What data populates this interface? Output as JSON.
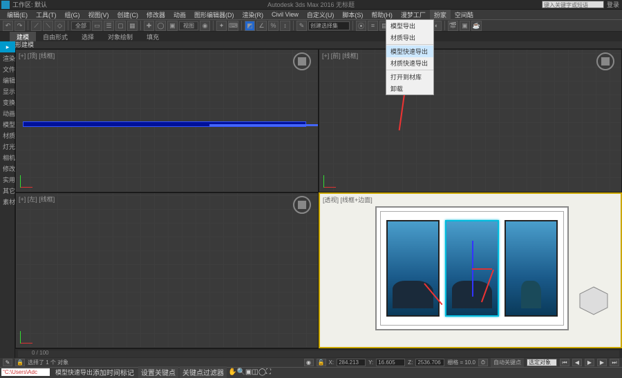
{
  "title": "Autodesk 3ds Max 2016   无标题",
  "workspace": "工作区: 默认",
  "search_placeholder": "键入关键字或短语",
  "login": "登录",
  "menubar": [
    "编辑(E)",
    "工具(T)",
    "组(G)",
    "视图(V)",
    "创建(C)",
    "修改器",
    "动画",
    "图形编辑器(D)",
    "渲染(R)",
    "Civil View",
    "自定义(U)",
    "脚本(S)",
    "帮助(H)",
    "漫梦工厂",
    "扮家",
    "空间酷"
  ],
  "toolbar_dd1": "全部",
  "toolbar_dd2": "视图",
  "toolbar_dd3": "创建选择集",
  "tabs": [
    "建模",
    "自由形式",
    "选择",
    "对象绘制",
    "填充"
  ],
  "subheader": "多边形建模",
  "left_items": [
    "渲染",
    "文件",
    "编辑",
    "显示",
    "变换",
    "动画",
    "模型",
    "材质",
    "灯光",
    "相机",
    "修改",
    "实用",
    "其它",
    "素材"
  ],
  "vp_labels": {
    "tl": "[+] [顶] [线框]",
    "tr": "[+] [前] [线框]",
    "bl": "[+] [左] [线框]",
    "br": "[透视] [线框+边面]"
  },
  "dropdown_items": [
    "模型导出",
    "材质导出",
    "模型快速导出",
    "材质快速导出",
    "打开到材库",
    "卸载"
  ],
  "timeline": {
    "range": "0 / 100",
    "start": 0,
    "end": 100
  },
  "status": {
    "selected": "选择了 1 个 对象",
    "x": "284.213",
    "y": "16.605",
    "z": "2536.706",
    "grid": "栅格 = 10.0",
    "autokey": "自动关键点",
    "selfilter": "选定对象",
    "setkey": "设置关键点",
    "keyfilter": "关键点过滤器"
  },
  "bottom": {
    "path": "\"C:\\Users\\Adc",
    "msg": "模型快速导出"
  },
  "prompt": "添加时间标记"
}
